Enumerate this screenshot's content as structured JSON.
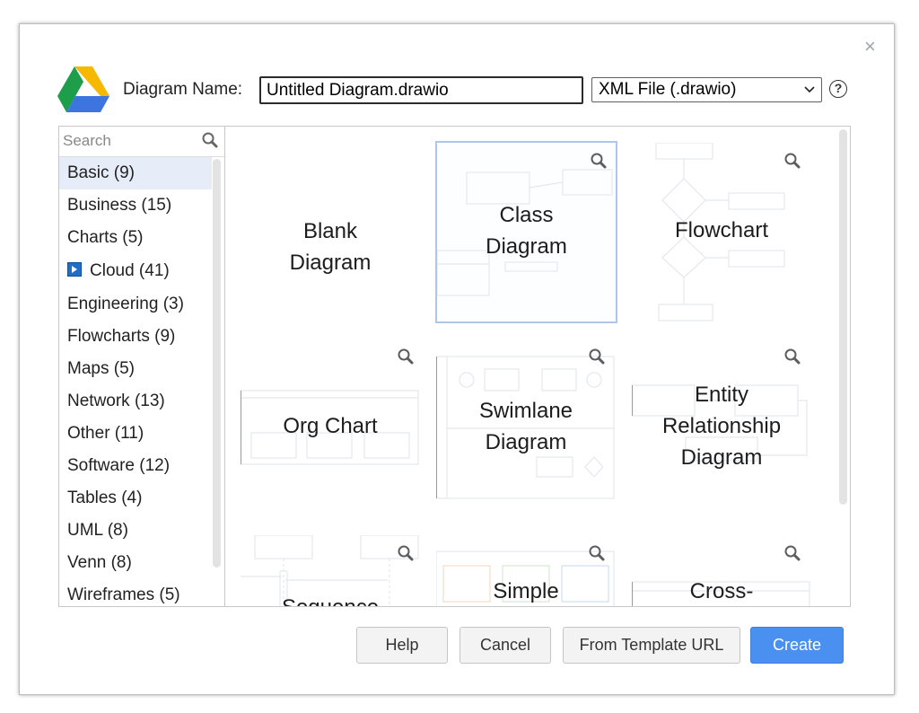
{
  "header": {
    "close_glyph": "×",
    "name_label": "Diagram Name:",
    "name_value": "Untitled Diagram.drawio",
    "file_type": "XML File (.drawio)",
    "help_glyph": "?"
  },
  "sidebar": {
    "search_placeholder": "Search",
    "categories": [
      {
        "label": "Basic (9)"
      },
      {
        "label": "Business (15)"
      },
      {
        "label": "Charts (5)"
      },
      {
        "label": "Cloud (41)"
      },
      {
        "label": "Engineering (3)"
      },
      {
        "label": "Flowcharts (9)"
      },
      {
        "label": "Maps (5)"
      },
      {
        "label": "Network (13)"
      },
      {
        "label": "Other (11)"
      },
      {
        "label": "Software (12)"
      },
      {
        "label": "Tables (4)"
      },
      {
        "label": "UML (8)"
      },
      {
        "label": "Venn (8)"
      },
      {
        "label": "Wireframes (5)"
      }
    ]
  },
  "templates": [
    {
      "line1": "Blank",
      "line2": "Diagram"
    },
    {
      "line1": "Class",
      "line2": "Diagram"
    },
    {
      "line1": "Flowchart"
    },
    {
      "line1": "Org Chart"
    },
    {
      "line1": "Swimlane",
      "line2": "Diagram"
    },
    {
      "line1": "Entity",
      "line2": "Relationship",
      "line3": "Diagram"
    },
    {
      "line1": "Sequence"
    },
    {
      "line1": "Simple"
    },
    {
      "line1": "Cross-"
    }
  ],
  "buttons": {
    "help": "Help",
    "cancel": "Cancel",
    "from_url": "From Template URL",
    "create": "Create"
  },
  "colors": {
    "accent": "#4a90f0",
    "selection": "#e6edf8"
  }
}
